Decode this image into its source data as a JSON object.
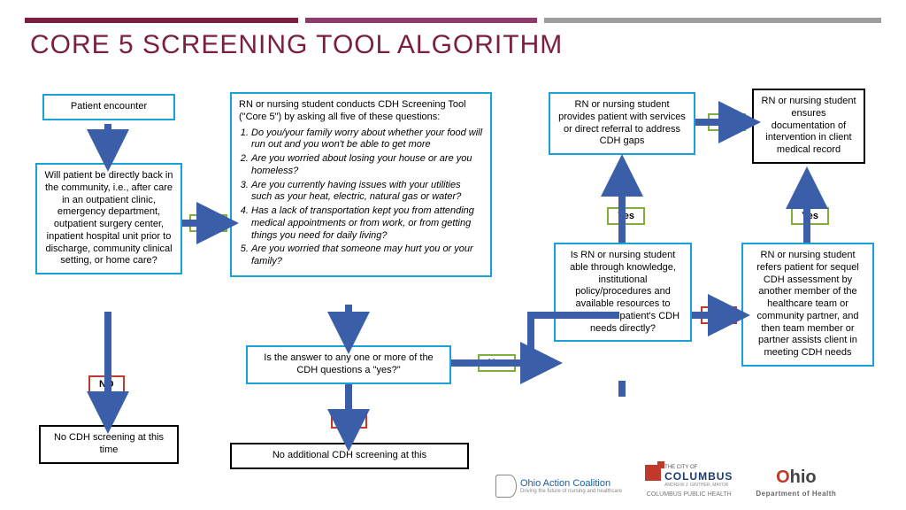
{
  "title": "CORE 5 SCREENING TOOL ALGORITHM",
  "nodes": {
    "patient": "Patient encounter",
    "community": "Will patient be directly back in the community, i.e., after care in an outpatient clinic, emergency department, outpatient surgery center, inpatient hospital unit prior to discharge, community clinical setting, or home care?",
    "noScreen": "No CDH screening at this time",
    "tool_lead": "RN or nursing student conducts CDH Screening Tool (\"Core 5\") by asking all five of these questions:",
    "q1": "Do you/your family worry about whether your food will run out and you won't be able to get more",
    "q2": "Are you worried about losing your house or are you homeless?",
    "q3": "Are you currently having issues with your utilities such as your heat, electric, natural gas or water?",
    "q4": "Has a lack of transportation kept you from attending medical appointments or from work, or from getting things you need for daily living?",
    "q5": "Are you worried that someone may hurt you or your family?",
    "anyYes": "Is the answer to any one or more of the CDH questions a \"yes?\"",
    "noAdd": "No additional CDH screening at this",
    "able": "Is RN or nursing student able through knowledge, institutional policy/procedures and available resources to address the patient's CDH needs directly?",
    "provides": "RN or nursing student provides patient with services or direct referral to address CDH gaps",
    "documents": "RN or nursing student ensures documentation of intervention in client medical record",
    "refers": "RN or nursing student refers patient for sequel CDH assessment by another member of the healthcare team or community partner, and then team member or partner assists client in meeting CDH needs"
  },
  "labels": {
    "yes": "Yes",
    "no": "NO"
  },
  "logos": {
    "oac": "Ohio Action Coalition",
    "oac_sub": "Driving the future of nursing and healthcare",
    "columbus": "COLUMBUS",
    "columbus_sub": "COLUMBUS PUBLIC HEALTH",
    "columbus_tag": "THE CITY OF",
    "columbus_mayor": "ANDREW J. GINTHER, MAYOR",
    "ohio": "Ohio",
    "doh": "Department of Health"
  },
  "chart_data": {
    "type": "flowchart",
    "title": "CORE 5 SCREENING TOOL ALGORITHM",
    "nodes": [
      {
        "id": "patient",
        "type": "start",
        "text": "Patient encounter"
      },
      {
        "id": "community",
        "type": "decision",
        "text": "Will patient be directly back in the community, i.e., after care in an outpatient clinic, emergency department, outpatient surgery center, inpatient hospital unit prior to discharge, community clinical setting, or home care?"
      },
      {
        "id": "noScreen",
        "type": "terminal",
        "text": "No CDH screening at this time"
      },
      {
        "id": "tool",
        "type": "process",
        "text": "RN or nursing student conducts CDH Screening Tool (\"Core 5\") by asking all five of these questions",
        "questions": [
          "Do you/your family worry about whether your food will run out and you won't be able to get more",
          "Are you worried about losing your house or are you homeless?",
          "Are you currently having issues with your utilities such as your heat, electric, natural gas or water?",
          "Has a lack of transportation kept you from attending medical appointments or from work, or from getting things you need for daily living?",
          "Are you worried that someone may hurt you or your family?"
        ]
      },
      {
        "id": "anyYes",
        "type": "decision",
        "text": "Is the answer to any one or more of the CDH questions a \"yes?\""
      },
      {
        "id": "noAdd",
        "type": "terminal",
        "text": "No additional CDH screening at this"
      },
      {
        "id": "able",
        "type": "decision",
        "text": "Is RN or nursing student able through knowledge, institutional policy/procedures and available resources to address the patient's CDH needs directly?"
      },
      {
        "id": "provides",
        "type": "process",
        "text": "RN or nursing student provides patient with services or direct referral to address CDH gaps"
      },
      {
        "id": "refers",
        "type": "process",
        "text": "RN or nursing student refers patient for sequel CDH assessment by another member of the healthcare team or community partner, and then team member or partner assists client in meeting CDH needs"
      },
      {
        "id": "documents",
        "type": "terminal",
        "text": "RN or nursing student ensures documentation of intervention in client medical record"
      }
    ],
    "edges": [
      {
        "from": "patient",
        "to": "community"
      },
      {
        "from": "community",
        "to": "noScreen",
        "label": "NO"
      },
      {
        "from": "community",
        "to": "tool",
        "label": "Yes"
      },
      {
        "from": "tool",
        "to": "anyYes"
      },
      {
        "from": "anyYes",
        "to": "noAdd",
        "label": "NO"
      },
      {
        "from": "anyYes",
        "to": "able",
        "label": "Yes"
      },
      {
        "from": "able",
        "to": "provides",
        "label": "Yes"
      },
      {
        "from": "able",
        "to": "refers",
        "label": "NO"
      },
      {
        "from": "provides",
        "to": "documents",
        "label": "Yes"
      },
      {
        "from": "refers",
        "to": "documents",
        "label": "Yes"
      }
    ]
  }
}
